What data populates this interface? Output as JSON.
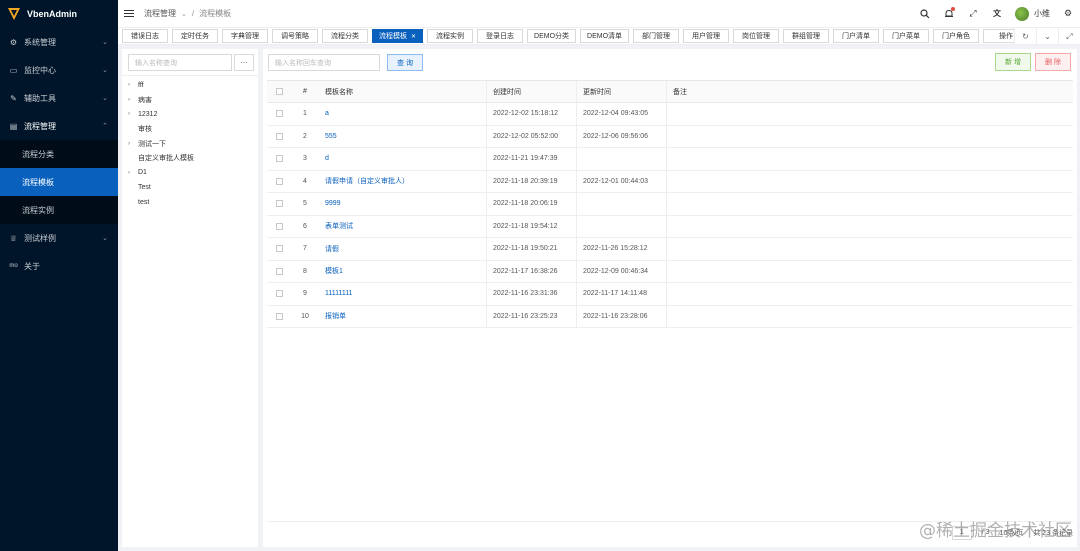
{
  "app": {
    "name": "VbenAdmin"
  },
  "sidebar": {
    "items": [
      {
        "label": "系统管理",
        "icon": "gear-icon"
      },
      {
        "label": "监控中心",
        "icon": "monitor-icon"
      },
      {
        "label": "辅助工具",
        "icon": "tool-icon"
      },
      {
        "label": "流程管理",
        "icon": "flow-icon",
        "open": true,
        "children": [
          {
            "label": "流程分类"
          },
          {
            "label": "流程模板",
            "active": true
          },
          {
            "label": "流程实例"
          }
        ]
      },
      {
        "label": "测试样例",
        "icon": "trophy-icon"
      },
      {
        "label": "关于",
        "icon": "about-icon"
      }
    ]
  },
  "header": {
    "breadcrumb": [
      "流程管理",
      "流程模板"
    ],
    "username": "小维"
  },
  "tabs": [
    "错误日志",
    "定时任务",
    "字典管理",
    "调号策略",
    "流程分类",
    "流程模板",
    "流程实例",
    "登录日志",
    "DEMO分类",
    "DEMO清单",
    "部门管理",
    "用户管理",
    "岗位管理",
    "群组管理",
    "门户清单",
    "门户菜单",
    "门户角色",
    "操作"
  ],
  "tree": {
    "search_placeholder": "输入名称查询",
    "more_label": "···",
    "nodes": [
      {
        "label": "fff",
        "caret": true
      },
      {
        "label": "病害",
        "caret": true
      },
      {
        "label": "12312",
        "caret": true
      },
      {
        "label": "审核",
        "caret": false
      },
      {
        "label": "测试一下",
        "caret": true
      },
      {
        "label": "自定义审批人模板",
        "caret": false
      },
      {
        "label": "D1",
        "caret": true
      },
      {
        "label": "Test",
        "caret": false
      },
      {
        "label": "test",
        "caret": false
      }
    ]
  },
  "main": {
    "search_placeholder": "输入名称回车查询",
    "query_label": "查 询",
    "add_label": "新 增",
    "delete_label": "删 除"
  },
  "table": {
    "headers": {
      "index": "#",
      "name": "模板名称",
      "created": "创建时间",
      "updated": "更新时间",
      "remark": "备注"
    },
    "rows": [
      {
        "index": "1",
        "name": "a",
        "created": "2022-12-02 15:18:12",
        "updated": "2022-12-04 09:43:05",
        "remark": ""
      },
      {
        "index": "2",
        "name": "555",
        "created": "2022-12-02 05:52:00",
        "updated": "2022-12-06 09:56:06",
        "remark": ""
      },
      {
        "index": "3",
        "name": "d",
        "created": "2022-11-21 19:47:39",
        "updated": "",
        "remark": ""
      },
      {
        "index": "4",
        "name": "请假申请（自定义审批人）",
        "created": "2022-11-18 20:39:19",
        "updated": "2022-12-01 00:44:03",
        "remark": ""
      },
      {
        "index": "5",
        "name": "9999",
        "created": "2022-11-18 20:06:19",
        "updated": "",
        "remark": ""
      },
      {
        "index": "6",
        "name": "表单测试",
        "created": "2022-11-18 19:54:12",
        "updated": "",
        "remark": ""
      },
      {
        "index": "7",
        "name": "请假",
        "created": "2022-11-18 19:50:21",
        "updated": "2022-11-26 15:28:12",
        "remark": ""
      },
      {
        "index": "8",
        "name": "模板1",
        "created": "2022-11-17 16:38:26",
        "updated": "2022-12-09 00:46:34",
        "remark": ""
      },
      {
        "index": "9",
        "name": "11111111",
        "created": "2022-11-16 23:31:36",
        "updated": "2022-11-17 14:11:48",
        "remark": ""
      },
      {
        "index": "10",
        "name": "报销单",
        "created": "2022-11-16 23:25:23",
        "updated": "2022-11-16 23:28:06",
        "remark": ""
      }
    ]
  },
  "pagination": {
    "page": "1",
    "pages": "/ 3",
    "page_size": "10条/页",
    "total": "共 23 条记录"
  },
  "watermark": "@稀土掘金技术社区"
}
